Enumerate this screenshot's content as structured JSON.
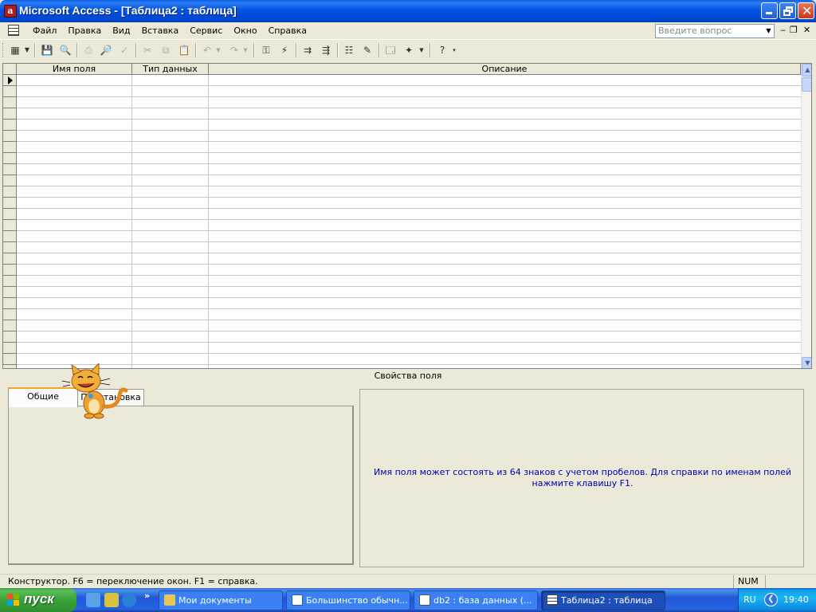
{
  "window": {
    "title": "Microsoft Access - [Таблица2 : таблица]",
    "app_icon_glyph": "a"
  },
  "menu": {
    "items": [
      "Файл",
      "Правка",
      "Вид",
      "Вставка",
      "Сервис",
      "Окно",
      "Справка"
    ],
    "help_placeholder": "Введите вопрос"
  },
  "grid": {
    "col_field_name": "Имя поля",
    "col_data_type": "Тип данных",
    "col_description": "Описание"
  },
  "properties": {
    "title": "Свойства поля",
    "tab_general": "Общие",
    "tab_lookup": "Подстановка",
    "hint": "Имя поля может состоять из 64 знаков с учетом пробелов.  Для справки по именам полей нажмите клавишу F1."
  },
  "status": {
    "text": "Конструктор.  F6 = переключение окон.  F1 = справка.",
    "num": "NUM"
  },
  "taskbar": {
    "start_label": "пуск",
    "tasks": [
      {
        "label": "Мои документы"
      },
      {
        "label": "Большинство обычн..."
      },
      {
        "label": "db2 : база данных (..."
      },
      {
        "label": "Таблица2 : таблица"
      }
    ],
    "lang": "RU",
    "clock": "19:40"
  },
  "colors": {
    "accent": "#0054e3",
    "hint_text": "#0000a8",
    "start_green": "#37a337"
  }
}
